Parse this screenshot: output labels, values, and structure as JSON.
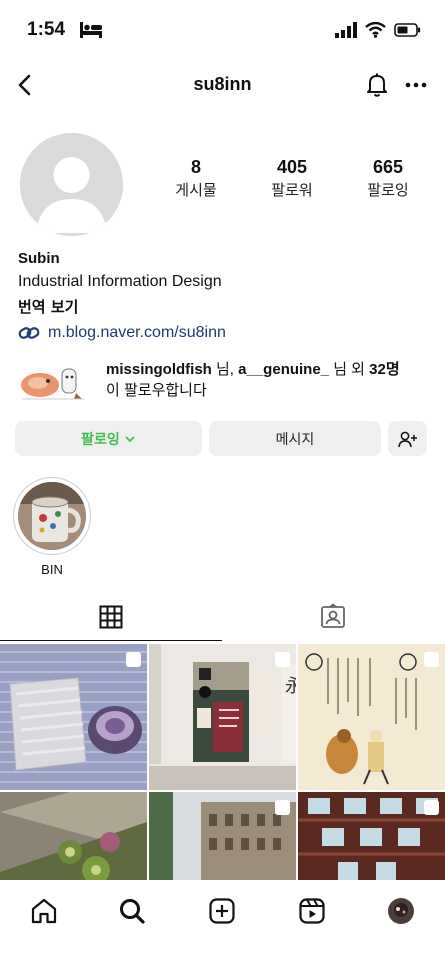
{
  "status": {
    "time": "1:54"
  },
  "header": {
    "username": "su8inn"
  },
  "stats": [
    {
      "value": "8",
      "label": "게시물"
    },
    {
      "value": "405",
      "label": "팔로워"
    },
    {
      "value": "665",
      "label": "팔로잉"
    }
  ],
  "bio": {
    "name": "Subin",
    "description": "Industrial Information Design",
    "translate": "번역 보기",
    "link": "m.blog.naver.com/su8inn"
  },
  "followed_by": {
    "user1": "missingoldfish",
    "sep1": " 님, ",
    "user2": "a__genuine_",
    "sep2": " 님 외 ",
    "count": "32명",
    "line2": "이 팔로우합니다"
  },
  "buttons": {
    "following": "팔로잉",
    "message": "메시지"
  },
  "highlights": [
    {
      "label": "BIN"
    }
  ],
  "colors": {
    "accent_green": "#3fbe4f",
    "link": "#1d3b75",
    "button_bg": "#efefef"
  },
  "icons": [
    "back-icon",
    "bell-icon",
    "more-icon",
    "link-icon",
    "add-user-icon",
    "grid-icon",
    "tagged-icon",
    "home-icon",
    "search-icon",
    "create-icon",
    "reels-icon"
  ]
}
